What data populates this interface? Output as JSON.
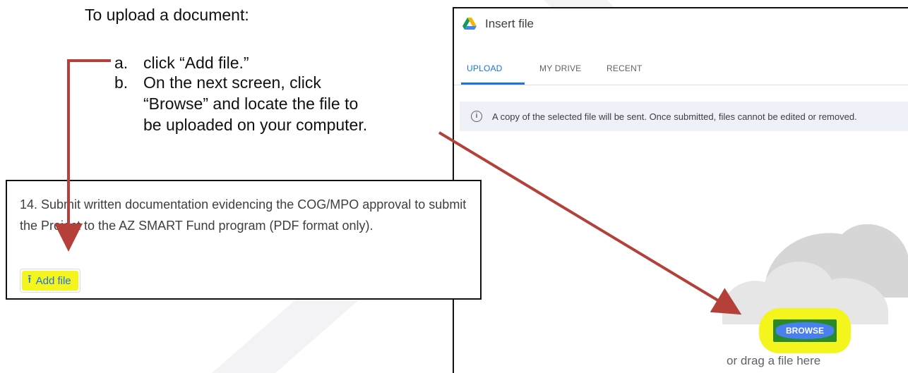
{
  "instructions": {
    "title": "To upload a document:",
    "steps": [
      {
        "letter": "a.",
        "lines": [
          "click “Add file.”"
        ]
      },
      {
        "letter": "b.",
        "lines": [
          "On the next screen, click",
          "“Browse” and locate the file to",
          "be uploaded on your computer."
        ]
      }
    ]
  },
  "form": {
    "question_lines": [
      "14. Submit written documentation evidencing the COG/MPO approval to submit",
      "the Project to the AZ SMART Fund program (PDF format only)."
    ],
    "add_file_label": "Add file",
    "add_file_icon": "upload-icon",
    "highlight_color": "#f5f51e"
  },
  "dialog": {
    "title": "Insert file",
    "logo": "google-drive-icon",
    "tabs": [
      {
        "label": "UPLOAD",
        "active": true
      },
      {
        "label": "MY DRIVE",
        "active": false
      },
      {
        "label": "RECENT",
        "active": false
      }
    ],
    "info_icon": "info-icon",
    "info_text": "A copy of the selected file will be sent. Once submitted, files cannot be edited or removed.",
    "browse_label": "BROWSE",
    "drag_text": "or drag a file here",
    "accent_color": "#1a73e8"
  },
  "annotations": {
    "arrow_color": "#b5403a"
  }
}
